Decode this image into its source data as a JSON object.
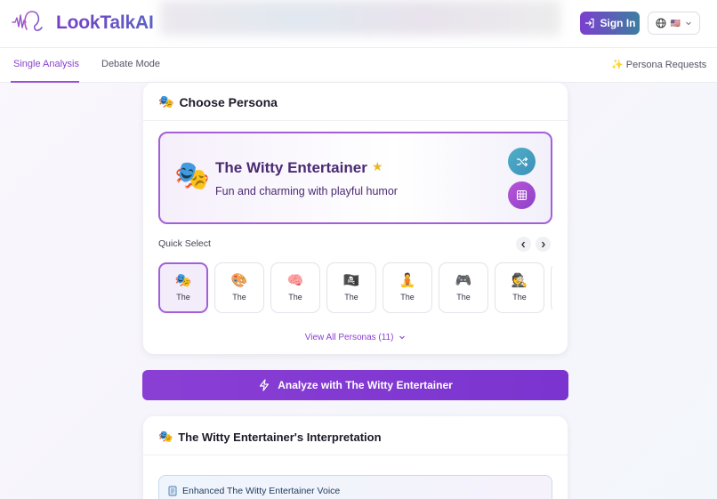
{
  "header": {
    "app_name": "LookTalkAI",
    "logo_icon": "sound-wave-icon",
    "signin_label": "Sign In",
    "language_flag": "🇺🇸"
  },
  "tabs": {
    "single": "Single Analysis",
    "debate": "Debate Mode",
    "requests": "✨ Persona Requests",
    "active": "Single Analysis"
  },
  "persona_section": {
    "title_emoji": "🎭",
    "title": "Choose Persona",
    "selected": {
      "emoji": "🎭",
      "name": "The Witty Entertainer",
      "star": "★",
      "description": "Fun and charming with playful humor"
    },
    "quick_select_label": "Quick Select",
    "quick_select": [
      {
        "emoji": "🎭",
        "name": "The",
        "active": true
      },
      {
        "emoji": "🎨",
        "name": "The",
        "active": false
      },
      {
        "emoji": "🧠",
        "name": "The",
        "active": false
      },
      {
        "emoji": "🏴‍☠️",
        "name": "The",
        "active": false
      },
      {
        "emoji": "🧘",
        "name": "The",
        "active": false
      },
      {
        "emoji": "🎮",
        "name": "The",
        "active": false
      },
      {
        "emoji": "🕵️",
        "name": "The",
        "active": false
      }
    ],
    "view_all": "View All Personas (11)"
  },
  "analyze_button": "Analyze with The Witty Entertainer",
  "interpretation": {
    "emoji": "🎭",
    "title": "The Witty Entertainer's Interpretation",
    "voice_icon": "document-icon",
    "voice_label": "Enhanced The Witty Entertainer Voice"
  },
  "colors": {
    "accent": "#8a3fd0",
    "brand_gradient_start": "#7a3ec8",
    "brand_gradient_end": "#5a62c4"
  }
}
